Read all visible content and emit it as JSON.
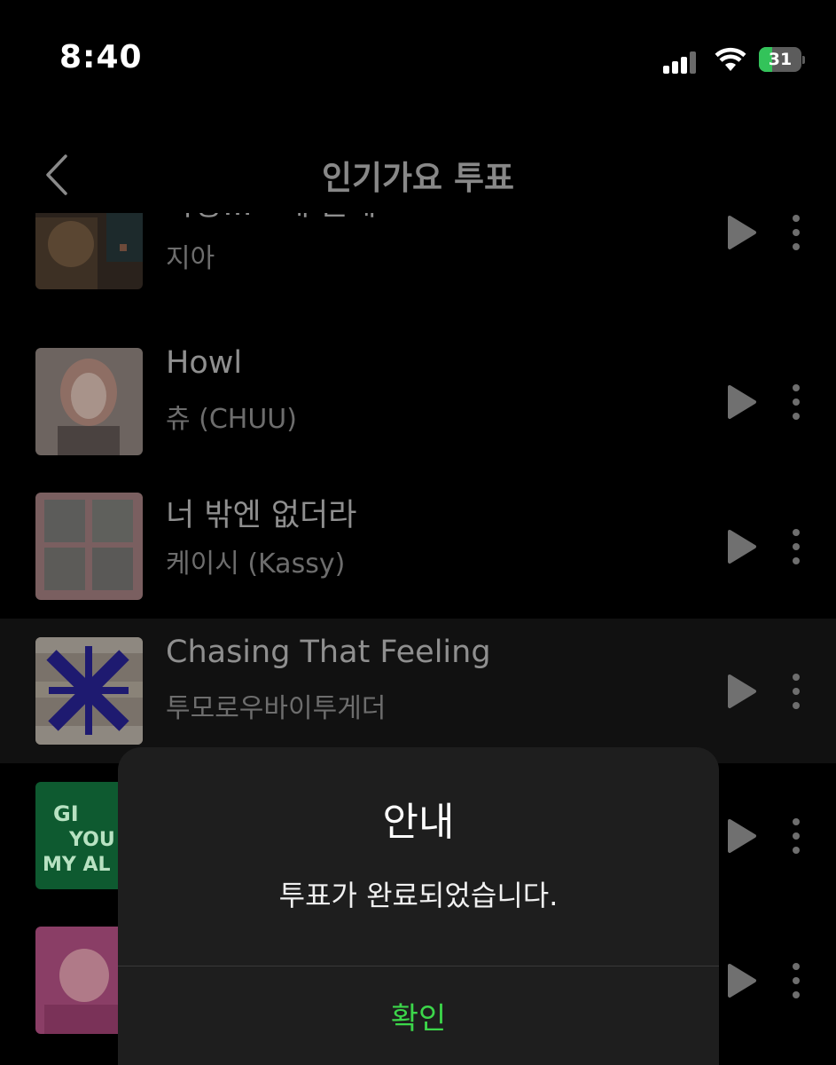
{
  "status_bar": {
    "time": "8:40",
    "battery": "31",
    "battery_level": 0.31,
    "charging": true
  },
  "nav": {
    "title": "인기가요 투표",
    "back_icon": "chevron-left-icon"
  },
  "songs": [
    {
      "title": "사랑...그게 뭔데",
      "artist": "지아"
    },
    {
      "title": "Howl",
      "artist": "츄 (CHUU)"
    },
    {
      "title": "너 밖엔 없더라",
      "artist": "케이시 (Kassy)"
    },
    {
      "title": "Chasing That Feeling",
      "artist": "투모로우바이투게더"
    },
    {
      "title": "",
      "artist": ""
    },
    {
      "title": "",
      "artist": ""
    }
  ],
  "dialog": {
    "title": "안내",
    "message": "투표가 완료되었습니다.",
    "confirm_label": "확인"
  },
  "colors": {
    "accent": "#3cd64a",
    "battery": "#33c35a",
    "background": "#000000"
  }
}
